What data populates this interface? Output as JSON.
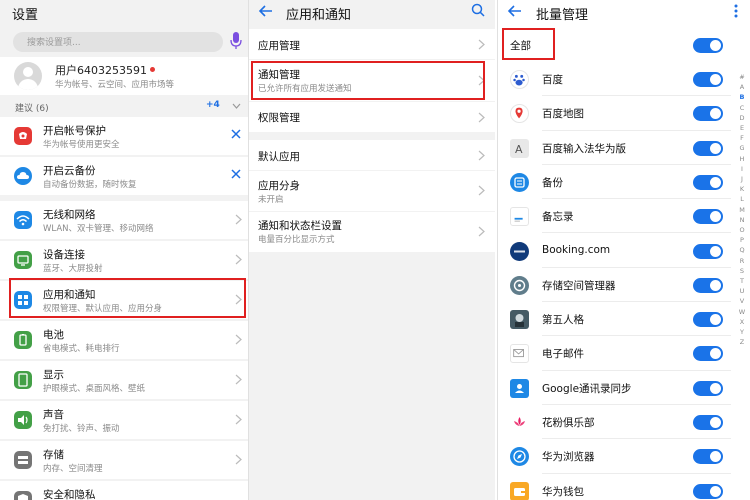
{
  "panel1": {
    "title": "设置",
    "search_placeholder": "搜索设置项...",
    "user": {
      "name": "用户6403253591",
      "sub": "华为帐号、云空间、应用市场等"
    },
    "suggestions": {
      "label": "建议 (6)",
      "count": "+4"
    },
    "suggest_items": [
      {
        "title": "开启帐号保护",
        "sub": "华为帐号使用更安全",
        "icon": "account-protect-icon"
      },
      {
        "title": "开启云备份",
        "sub": "自动备份数据，随时恢复",
        "icon": "cloud-backup-icon"
      }
    ],
    "items": [
      {
        "title": "无线和网络",
        "sub": "WLAN、双卡管理、移动网络",
        "icon": "wifi-icon"
      },
      {
        "title": "设备连接",
        "sub": "蓝牙、大屏投射",
        "icon": "device-connect-icon"
      },
      {
        "title": "应用和通知",
        "sub": "权限管理、默认应用、应用分身",
        "icon": "apps-icon"
      },
      {
        "title": "电池",
        "sub": "省电模式、耗电排行",
        "icon": "battery-icon"
      },
      {
        "title": "显示",
        "sub": "护眼模式、桌面风格、壁纸",
        "icon": "display-icon"
      },
      {
        "title": "声音",
        "sub": "免打扰、铃声、振动",
        "icon": "sound-icon"
      },
      {
        "title": "存储",
        "sub": "内存、空间清理",
        "icon": "storage-icon"
      },
      {
        "title": "安全和隐私",
        "sub": "",
        "icon": "security-icon"
      }
    ]
  },
  "panel2": {
    "title": "应用和通知",
    "group1": [
      {
        "title": "应用管理",
        "sub": ""
      },
      {
        "title": "通知管理",
        "sub": "已允许所有应用发送通知"
      },
      {
        "title": "权限管理",
        "sub": ""
      }
    ],
    "group2": [
      {
        "title": "默认应用",
        "sub": ""
      },
      {
        "title": "应用分身",
        "sub": "未开启"
      },
      {
        "title": "通知和状态栏设置",
        "sub": "电量百分比显示方式"
      }
    ]
  },
  "panel3": {
    "title": "批量管理",
    "all_label": "全部",
    "apps": [
      {
        "name": "百度",
        "icon": "baidu-icon",
        "enabled": true
      },
      {
        "name": "百度地图",
        "icon": "baidu-map-icon",
        "enabled": true
      },
      {
        "name": "百度输入法华为版",
        "icon": "baidu-input-icon",
        "enabled": true
      },
      {
        "name": "备份",
        "icon": "backup-icon",
        "enabled": true
      },
      {
        "name": "备忘录",
        "icon": "notes-icon",
        "enabled": true
      },
      {
        "name": "Booking.com",
        "icon": "booking-icon",
        "enabled": true
      },
      {
        "name": "存储空间管理器",
        "icon": "storage-manager-icon",
        "enabled": true
      },
      {
        "name": "第五人格",
        "icon": "identity-v-icon",
        "enabled": true
      },
      {
        "name": "电子邮件",
        "icon": "email-icon",
        "enabled": true
      },
      {
        "name": "Google通讯录同步",
        "icon": "google-contacts-icon",
        "enabled": true
      },
      {
        "name": "花粉俱乐部",
        "icon": "huafen-club-icon",
        "enabled": true
      },
      {
        "name": "华为浏览器",
        "icon": "huawei-browser-icon",
        "enabled": true
      },
      {
        "name": "华为钱包",
        "icon": "huawei-wallet-icon",
        "enabled": true
      }
    ],
    "alphabet": [
      "#",
      "A",
      "B",
      "C",
      "D",
      "E",
      "F",
      "G",
      "H",
      "I",
      "J",
      "K",
      "L",
      "M",
      "N",
      "O",
      "P",
      "Q",
      "R",
      "S",
      "T",
      "U",
      "V",
      "W",
      "X",
      "Y",
      "Z"
    ],
    "alphabet_active": "B"
  }
}
